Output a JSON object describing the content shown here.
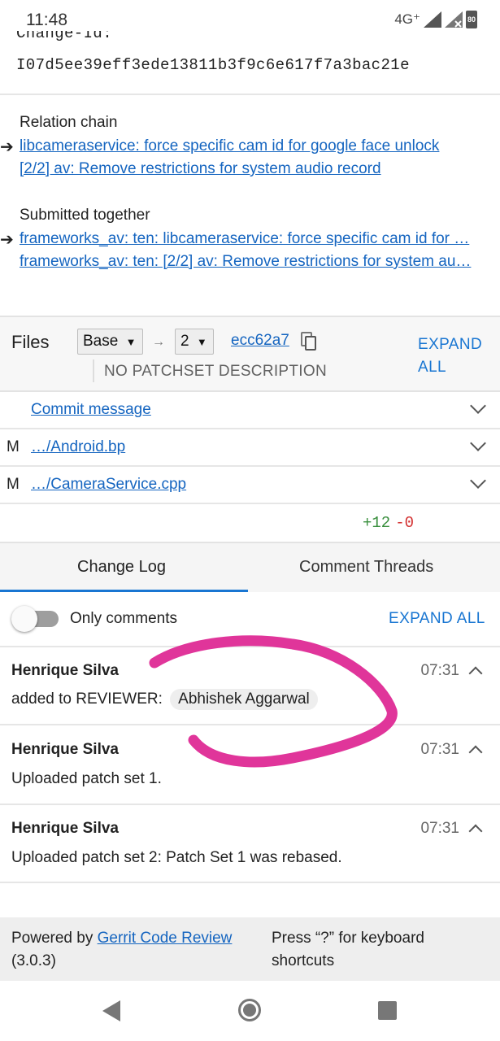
{
  "status_bar": {
    "time": "11:48",
    "network": "4G⁺",
    "battery": "80"
  },
  "change_id": {
    "label": "Change-Id:",
    "value": "I07d5ee39eff3ede13811b3f9c6e617f7a3bac21e"
  },
  "relation_chain": {
    "title": "Relation chain",
    "items": [
      "libcameraservice: force specific cam id for google face unlock",
      "[2/2] av: Remove restrictions for system audio record"
    ]
  },
  "submitted_together": {
    "title": "Submitted together",
    "items": [
      "frameworks_av: ten: libcameraservice: force specific cam id for …",
      "frameworks_av: ten: [2/2] av: Remove restrictions for system au…"
    ]
  },
  "files": {
    "title": "Files",
    "base_select": "Base",
    "arrow": "→",
    "patchset_select": "2",
    "commit_hash": "ecc62a7",
    "expand_all": [
      "EXPAND",
      "ALL"
    ],
    "no_patchset_description": "NO PATCHSET DESCRIPTION",
    "rows": [
      {
        "status": "",
        "name": "Commit message"
      },
      {
        "status": "M",
        "name": "…/Android.bp"
      },
      {
        "status": "M",
        "name": "…/CameraService.cpp"
      }
    ],
    "added": "+12",
    "removed": "-0"
  },
  "tabs": {
    "change_log": "Change Log",
    "comment_threads": "Comment Threads"
  },
  "log_controls": {
    "only_comments": "Only comments",
    "expand_all": "EXPAND ALL"
  },
  "messages": [
    {
      "author": "Henrique Silva",
      "time": "07:31",
      "text": "added to REVIEWER:",
      "chip": "Abhishek Aggarwal"
    },
    {
      "author": "Henrique Silva",
      "time": "07:31",
      "text": "Uploaded patch set 1."
    },
    {
      "author": "Henrique Silva",
      "time": "07:31",
      "text": "Uploaded patch set 2: Patch Set 1 was rebased."
    }
  ],
  "footer": {
    "powered_by": "Powered by",
    "gerrit_link": "Gerrit Code Review",
    "version": "(3.0.3)",
    "shortcuts_hint": "Press “?” for keyboard shortcuts"
  },
  "colors": {
    "link": "#1565c0",
    "accent": "#1976d2",
    "annotation": "#e0359a",
    "added": "#388e3c",
    "removed": "#d32f2f"
  }
}
